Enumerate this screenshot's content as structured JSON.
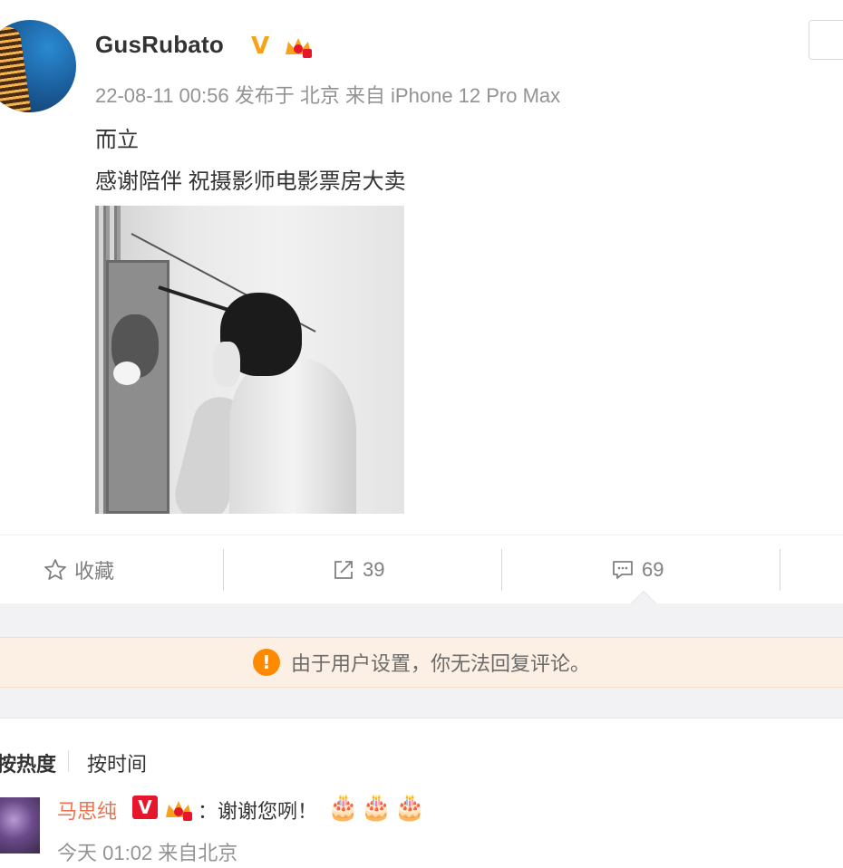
{
  "post": {
    "author": "GusRubato",
    "verified_mark": "V",
    "meta": "22-08-11 00:56 发布于 北京 来自 iPhone 12 Pro Max",
    "line1": "而立",
    "line2": "感谢陪伴 祝摄影师电影票房大卖"
  },
  "actions": {
    "favorite_label": "收藏",
    "repost_count": "39",
    "comment_count": "69"
  },
  "notice": {
    "icon_glyph": "!",
    "text": "由于用户设置，你无法回复评论。"
  },
  "comments": {
    "sort_hot": "按热度",
    "sort_time": "按时间",
    "items": [
      {
        "name": "马思纯",
        "verified_mark": "V",
        "text": "：谢谢您咧！",
        "emoji_glyphs": [
          "🎂",
          "🎂",
          "🎂"
        ],
        "meta": "今天 01:02 来自北京"
      }
    ]
  },
  "colors": {
    "accent_orange": "#ff8a00",
    "commenter_name": "#eb7350",
    "verified_red": "#e6162d",
    "verified_gold": "#f7a319"
  },
  "icons": [
    "star-icon",
    "repost-icon",
    "comment-icon",
    "warning-icon",
    "crown-badge-icon",
    "cake-icon"
  ]
}
